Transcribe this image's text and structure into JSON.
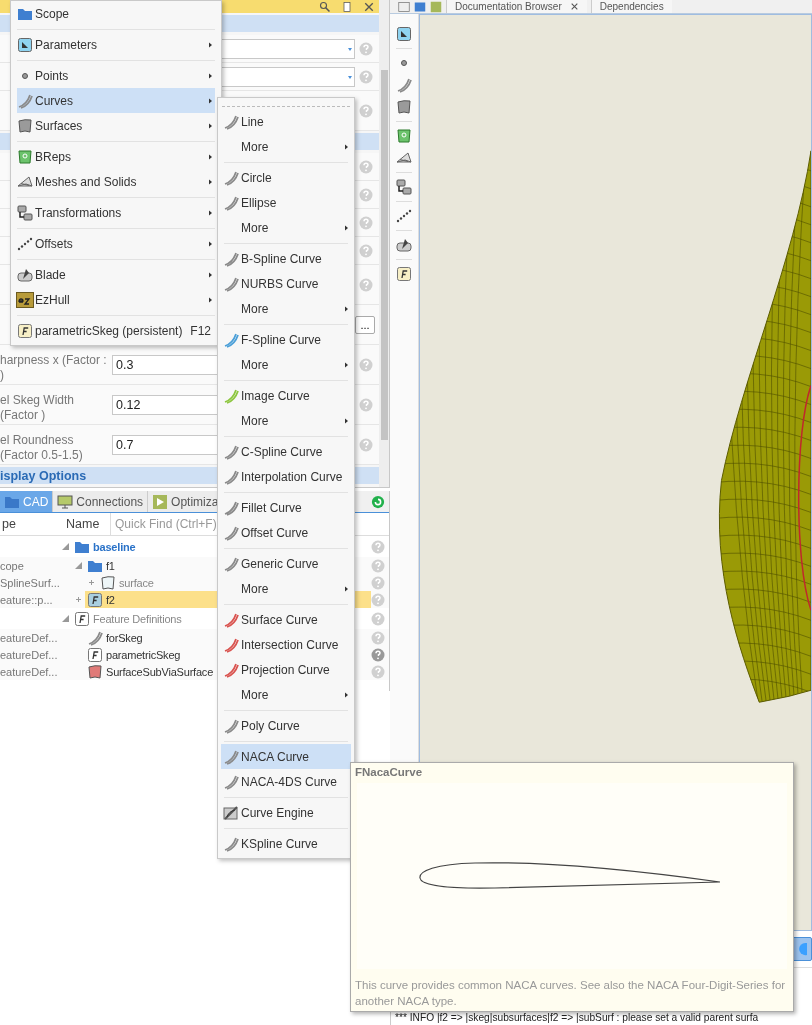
{
  "properties_panel": {
    "sections": [
      {
        "rows": [
          {
            "kind": "combo"
          },
          {
            "kind": "combo"
          },
          {
            "kind": "tall"
          }
        ]
      },
      {
        "rows": [
          {
            "kind": "short"
          },
          {
            "kind": "short"
          },
          {
            "kind": "short"
          },
          {
            "kind": "short"
          },
          {
            "kind": "tall"
          },
          {
            "kind": "browse",
            "button": "..."
          },
          {
            "kind": "value",
            "label": "harpness x (Factor : )",
            "value": "0.3"
          },
          {
            "kind": "value",
            "label": "el Skeg Width (Factor )",
            "value": "0.12"
          },
          {
            "kind": "value",
            "label": "el Roundness (Factor 0.5-1.5)",
            "value": "0.7"
          }
        ]
      },
      {
        "title": "isplay Options"
      }
    ]
  },
  "tree_panel": {
    "tabs": [
      {
        "label": "CAD",
        "selected": true
      },
      {
        "label": "Connections",
        "selected": false
      },
      {
        "label": "Optimiza",
        "selected": false
      }
    ],
    "columns": [
      "pe",
      "Name"
    ],
    "search": {
      "placeholder": "Quick Find (Ctrl+F)"
    },
    "nodes": [
      {
        "name": "baseline",
        "kind": "scope",
        "expanded": true,
        "selected": false,
        "children": [
          {
            "name": "f1",
            "type": "cope",
            "kind": "folder",
            "expanded": true,
            "selected": false,
            "children": [
              {
                "name": "surface",
                "type": "SplineSurf...",
                "kind": "surface",
                "expanded": false,
                "selected": false
              }
            ]
          },
          {
            "name": "f2",
            "type": "eature::p...",
            "kind": "feature",
            "expanded": false,
            "selected": true
          }
        ]
      },
      {
        "name": "Feature Definitions",
        "kind": "category",
        "expanded": true,
        "selected": false,
        "children": [
          {
            "name": "forSkeg",
            "type": "eatureDef...",
            "kind": "curve",
            "selected": false
          },
          {
            "name": "parametricSkeg",
            "type": "eatureDef...",
            "kind": "definition",
            "selected": false
          },
          {
            "name": "SurfaceSubViaSurface",
            "type": "eatureDef...",
            "kind": "patch",
            "selected": false
          }
        ]
      }
    ]
  },
  "view_tabs": [
    {
      "label": "Documentation Browser",
      "closable": true
    },
    {
      "label": "Dependencies",
      "closable": false
    }
  ],
  "log": {
    "lines": [
      "*** INFO |f2 => |skeg|subsurfaces|f2 => |subSurf : please set a valid parent surfa"
    ]
  },
  "main_menu": {
    "groups": [
      [
        {
          "label": "Scope",
          "submenu": false,
          "selected": false
        }
      ],
      [
        {
          "label": "Parameters",
          "submenu": true,
          "selected": false
        }
      ],
      [
        {
          "label": "Points",
          "submenu": true,
          "selected": false
        },
        {
          "label": "Curves",
          "submenu": true,
          "selected": true
        },
        {
          "label": "Surfaces",
          "submenu": true,
          "selected": false
        }
      ],
      [
        {
          "label": "BReps",
          "submenu": true,
          "selected": false
        },
        {
          "label": "Meshes and Solids",
          "submenu": true,
          "selected": false
        }
      ],
      [
        {
          "label": "Transformations",
          "submenu": true,
          "selected": false
        }
      ],
      [
        {
          "label": "Offsets",
          "submenu": true,
          "selected": false
        }
      ],
      [
        {
          "label": "Blade",
          "submenu": true,
          "selected": false
        },
        {
          "label": "EzHull",
          "submenu": true,
          "selected": false
        }
      ],
      [
        {
          "label": "parametricSkeg (persistent)",
          "shortcut": "F12",
          "submenu": false,
          "selected": false
        }
      ]
    ]
  },
  "curves_menu": {
    "groups": [
      [
        {
          "label": "Line",
          "kind": "curve",
          "color": "#8a8a8a",
          "selected": false
        },
        {
          "label": "More",
          "kind": "more",
          "selected": false
        }
      ],
      [
        {
          "label": "Circle",
          "kind": "curve",
          "color": "#8a8a8a",
          "selected": false
        },
        {
          "label": "Ellipse",
          "kind": "curve",
          "color": "#8a8a8a",
          "selected": false
        },
        {
          "label": "More",
          "kind": "more",
          "selected": false
        }
      ],
      [
        {
          "label": "B-Spline Curve",
          "kind": "curve",
          "color": "#8a8a8a",
          "selected": false
        },
        {
          "label": "NURBS Curve",
          "kind": "curve",
          "color": "#8a8a8a",
          "selected": false
        },
        {
          "label": "More",
          "kind": "more",
          "selected": false
        }
      ],
      [
        {
          "label": "F-Spline Curve",
          "kind": "curve",
          "color": "#4a9fd8",
          "selected": false
        },
        {
          "label": "More",
          "kind": "more",
          "selected": false
        }
      ],
      [
        {
          "label": "Image Curve",
          "kind": "curve",
          "color": "#8cc63e",
          "selected": false
        },
        {
          "label": "More",
          "kind": "more",
          "selected": false
        }
      ],
      [
        {
          "label": "C-Spline Curve",
          "kind": "curve",
          "color": "#8a8a8a",
          "selected": false
        },
        {
          "label": "Interpolation Curve",
          "kind": "curve",
          "color": "#8a8a8a",
          "selected": false
        }
      ],
      [
        {
          "label": "Fillet Curve",
          "kind": "curve",
          "color": "#8a8a8a",
          "selected": false
        },
        {
          "label": "Offset Curve",
          "kind": "curve",
          "color": "#8a8a8a",
          "selected": false
        }
      ],
      [
        {
          "label": "Generic Curve",
          "kind": "curve",
          "color": "#8a8a8a",
          "selected": false
        },
        {
          "label": "More",
          "kind": "more",
          "selected": false
        }
      ],
      [
        {
          "label": "Surface Curve",
          "kind": "curve",
          "color": "#d9534f",
          "selected": false
        },
        {
          "label": "Intersection Curve",
          "kind": "curve",
          "color": "#d9534f",
          "selected": false
        },
        {
          "label": "Projection Curve",
          "kind": "curve",
          "color": "#d9534f",
          "selected": false
        },
        {
          "label": "More",
          "kind": "more",
          "selected": false
        }
      ],
      [
        {
          "label": "Poly Curve",
          "kind": "curve",
          "color": "#8a8a8a",
          "selected": false
        }
      ],
      [
        {
          "label": "NACA Curve",
          "kind": "curve",
          "color": "#8a8a8a",
          "selected": true
        },
        {
          "label": "NACA-4DS Curve",
          "kind": "curve",
          "color": "#8a8a8a",
          "selected": false
        }
      ],
      [
        {
          "label": "Curve Engine",
          "kind": "engine",
          "selected": false
        }
      ],
      [
        {
          "label": "KSpline Curve",
          "kind": "curve",
          "color": "#8a8a8a",
          "selected": false
        }
      ]
    ]
  },
  "tooltip": {
    "title": "FNacaCurve",
    "description": "This curve provides common NACA curves. See also the NACA Four-Digit-Series for another NACA type."
  }
}
